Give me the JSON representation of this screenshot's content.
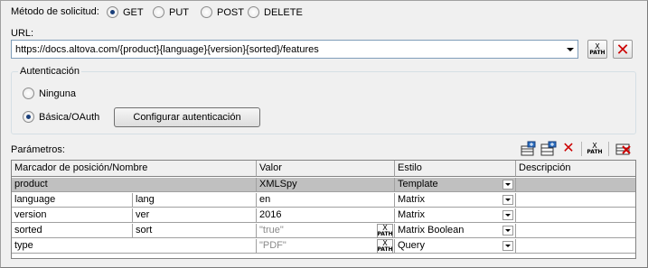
{
  "method": {
    "label": "Método de solicitud:",
    "options": [
      "GET",
      "PUT",
      "POST",
      "DELETE"
    ],
    "selected": "GET"
  },
  "url": {
    "label": "URL:",
    "value": "https://docs.altova.com/{product}{language}{version}{sorted}/features",
    "xpath_button": {
      "top": "X",
      "bottom": "PATH"
    }
  },
  "auth": {
    "title": "Autenticación",
    "options": [
      "Ninguna",
      "Básica/OAuth"
    ],
    "selected": "Básica/OAuth",
    "configure_button": "Configurar autenticación"
  },
  "params": {
    "label": "Parámetros:",
    "columns": [
      "Marcador de posición/Nombre",
      "Valor",
      "Estilo",
      "Descripción"
    ],
    "rows": [
      {
        "placeholder": "product",
        "name": "",
        "value": "XMLSpy",
        "value_is_placeholder": false,
        "style": "Template",
        "description": "",
        "xpath": false,
        "group": true
      },
      {
        "placeholder": "language",
        "name": "lang",
        "value": "en",
        "value_is_placeholder": false,
        "style": "Matrix",
        "description": "",
        "xpath": false,
        "group": false
      },
      {
        "placeholder": "version",
        "name": "ver",
        "value": "2016",
        "value_is_placeholder": false,
        "style": "Matrix",
        "description": "",
        "xpath": false,
        "group": false
      },
      {
        "placeholder": "sorted",
        "name": "sort",
        "value": "\"true\"",
        "value_is_placeholder": true,
        "style": "Matrix Boolean",
        "description": "",
        "xpath": true,
        "group": false
      },
      {
        "placeholder": "type",
        "name": "",
        "value": "\"PDF\"",
        "value_is_placeholder": true,
        "style": "Query",
        "description": "",
        "xpath": true,
        "group": false
      }
    ]
  },
  "colors": {
    "remove_red": "#cc0000",
    "group_row_bg": "#c0c0c0",
    "placeholder_grey": "#8a8a8a"
  }
}
